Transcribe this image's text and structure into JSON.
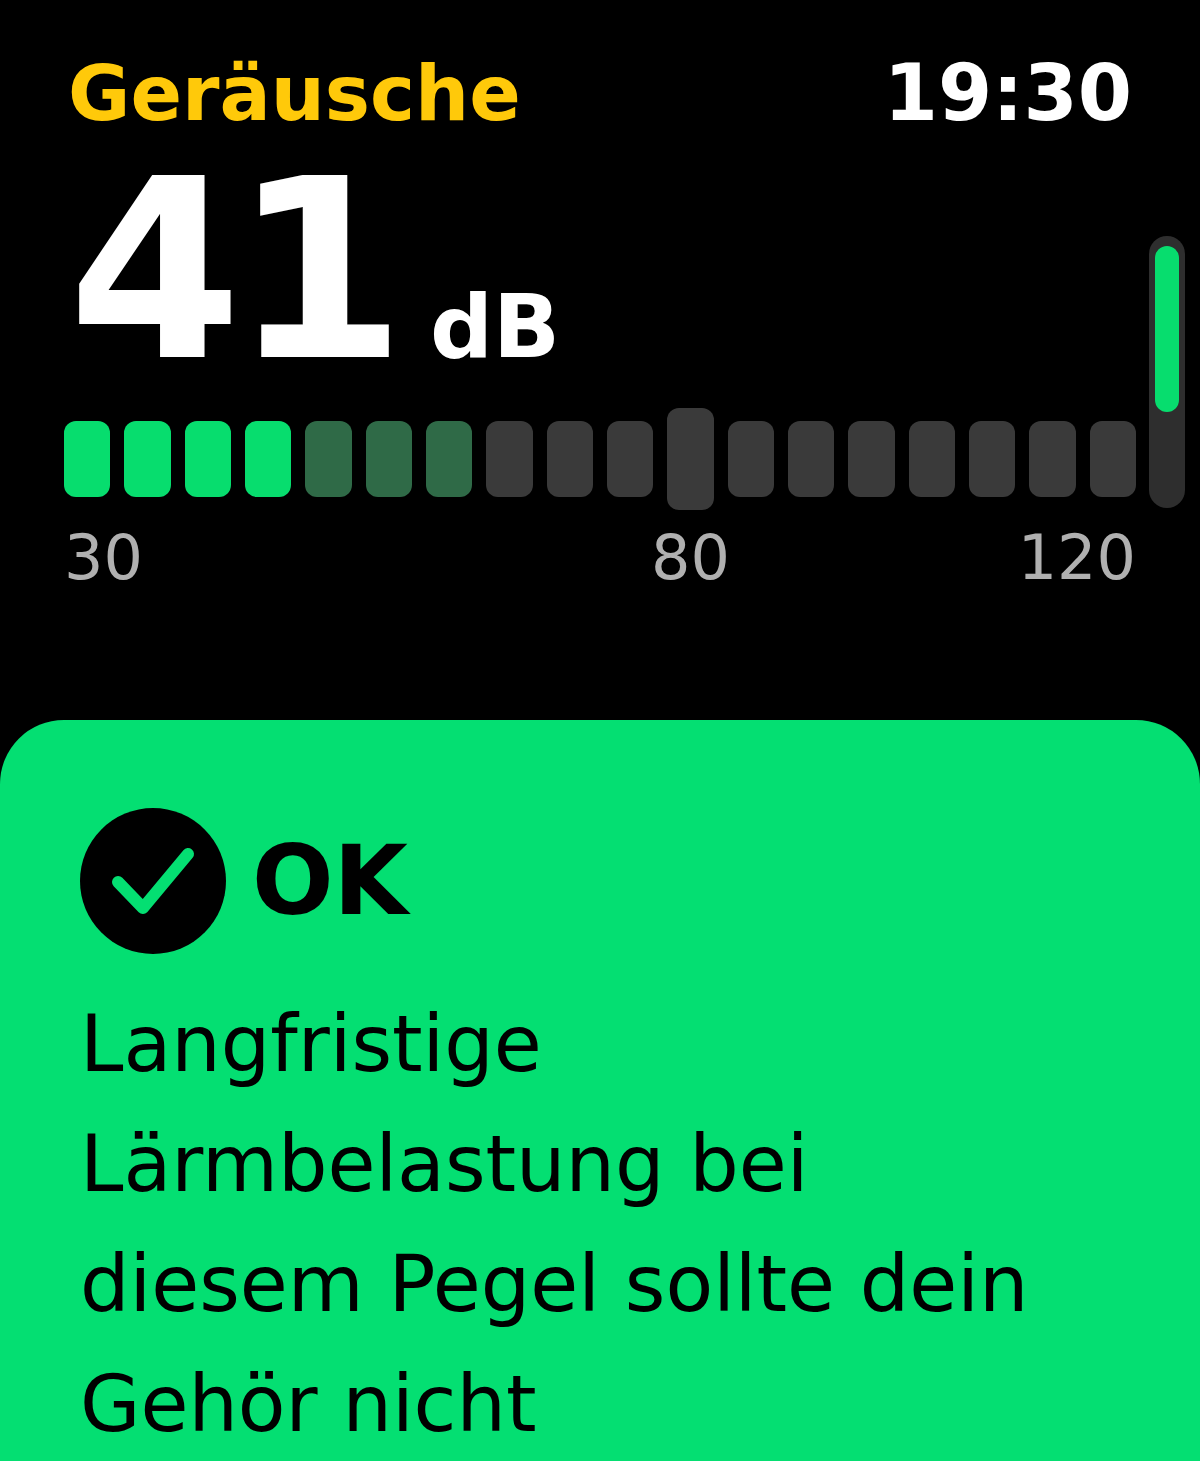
{
  "header": {
    "title": "Geräusche",
    "time": "19:30"
  },
  "reading": {
    "value": "41",
    "unit": "dB"
  },
  "meter": {
    "segments": [
      {
        "kind": "current",
        "threshold": false
      },
      {
        "kind": "current",
        "threshold": false
      },
      {
        "kind": "current",
        "threshold": false
      },
      {
        "kind": "current",
        "threshold": false
      },
      {
        "kind": "recent",
        "threshold": false
      },
      {
        "kind": "recent",
        "threshold": false
      },
      {
        "kind": "recent",
        "threshold": false
      },
      {
        "kind": "off",
        "threshold": false
      },
      {
        "kind": "off",
        "threshold": false
      },
      {
        "kind": "off",
        "threshold": false
      },
      {
        "kind": "off",
        "threshold": true
      },
      {
        "kind": "off",
        "threshold": false
      },
      {
        "kind": "off",
        "threshold": false
      },
      {
        "kind": "off",
        "threshold": false
      },
      {
        "kind": "off",
        "threshold": false
      },
      {
        "kind": "off",
        "threshold": false
      },
      {
        "kind": "off",
        "threshold": false
      },
      {
        "kind": "off",
        "threshold": false
      }
    ],
    "scale": [
      "30",
      "80",
      "120"
    ]
  },
  "status": {
    "label": "OK",
    "message": "Langfristige Lärmbelastung bei diesem Pegel sollte dein Gehör nicht"
  }
}
